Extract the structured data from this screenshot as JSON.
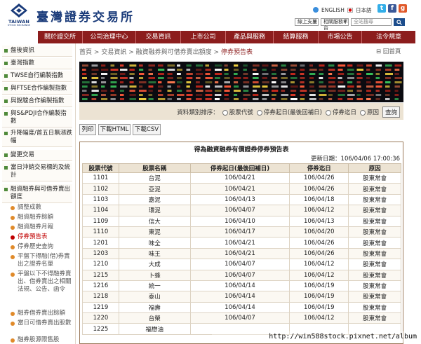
{
  "header": {
    "logo_en": "TAIWAN",
    "logo_en2": "STOCK EXCHANGE",
    "site_title": "臺灣證券交易所",
    "lang_english": "ENGLISH",
    "lang_japanese": "日本語",
    "select_support": "線上支援",
    "select_platform": "相關服務平台",
    "search_placeholder": "全站搜尋",
    "search_button": "Q",
    "social": [
      "t",
      "f",
      "g"
    ]
  },
  "nav": {
    "items": [
      "關於證交所",
      "公司治理中心",
      "交易資訊",
      "上市公司",
      "產品與服務",
      "結算服務",
      "市場公告",
      "法令規章"
    ]
  },
  "sidebar": {
    "items": [
      "盤後資訊",
      "臺灣指數",
      "TWSE自行編製指數",
      "與FTSE合作編製指數",
      "與銳駿合作編製指數",
      "與S&PDJI合作編製指數",
      "升降幅度/首五日無漲跌幅",
      "變更交易",
      "當日沖銷交易標的及統計",
      "融資融券與可借券賣出額度"
    ],
    "subitems": [
      "調整成數",
      "融資融券餘額",
      "融資融券月報",
      "停券預告表",
      "停券歷史查詢",
      "平盤下得融(借)券賣出之證券名單",
      "平盤以下不得融券賣出、借券賣出之相關法規、公告、函令",
      "融券借券賣出餘額",
      "當日可借券賣出股數",
      "融券股源限售股"
    ],
    "active_sub_index": 3
  },
  "breadcrumb": {
    "home": "首頁",
    "sep": ">",
    "level1": "交易資訊",
    "level2": "融資融券與可借券賣出額度",
    "current": "停券預告表",
    "back_home": "回首頁"
  },
  "sort": {
    "label": "資料類別排序：",
    "options": [
      "股票代號",
      "停券起日(最後回補日)",
      "停券迄日",
      "原因"
    ],
    "query_button": "查詢"
  },
  "buttons": {
    "print": "列印",
    "download_html": "下載HTML",
    "download_csv": "下載CSV"
  },
  "table": {
    "title": "得為融資融券有價證券停券預告表",
    "updated": "更新日期：106/04/06 17:00:36",
    "columns": [
      "股票代號",
      "股票名稱",
      "停券起日(最後回補日)",
      "停券迄日",
      "原因"
    ],
    "rows": [
      [
        "1101",
        "台泥",
        "106/04/21",
        "106/04/26",
        "股東常會"
      ],
      [
        "1102",
        "亞泥",
        "106/04/21",
        "106/04/26",
        "股東常會"
      ],
      [
        "1103",
        "嘉泥",
        "106/04/13",
        "106/04/18",
        "股東常會"
      ],
      [
        "1104",
        "環泥",
        "106/04/07",
        "106/04/12",
        "股東常會"
      ],
      [
        "1109",
        "信大",
        "106/04/10",
        "106/04/13",
        "股東常會"
      ],
      [
        "1110",
        "東泥",
        "106/04/17",
        "106/04/20",
        "股東常會"
      ],
      [
        "1201",
        "味全",
        "106/04/21",
        "106/04/26",
        "股東常會"
      ],
      [
        "1203",
        "味王",
        "106/04/21",
        "106/04/26",
        "股東常會"
      ],
      [
        "1210",
        "大成",
        "106/04/07",
        "106/04/12",
        "股東常會"
      ],
      [
        "1215",
        "卜蜂",
        "106/04/07",
        "106/04/12",
        "股東常會"
      ],
      [
        "1216",
        "統一",
        "106/04/14",
        "106/04/19",
        "股東常會"
      ],
      [
        "1218",
        "泰山",
        "106/04/14",
        "106/04/19",
        "股東常會"
      ],
      [
        "1219",
        "福壽",
        "106/04/14",
        "106/04/19",
        "股東常會"
      ],
      [
        "1220",
        "台榮",
        "106/04/07",
        "106/04/12",
        "股東常會"
      ],
      [
        "1225",
        "福懋油",
        "",
        "",
        ""
      ]
    ]
  },
  "watermark": "http://win588stock.pixnet.net/album",
  "colors": {
    "nav_bg": "#8c1d1d",
    "brand_blue": "#1a3b7a",
    "table_header_bg": "#ece3d3",
    "active_link": "#c00000"
  }
}
